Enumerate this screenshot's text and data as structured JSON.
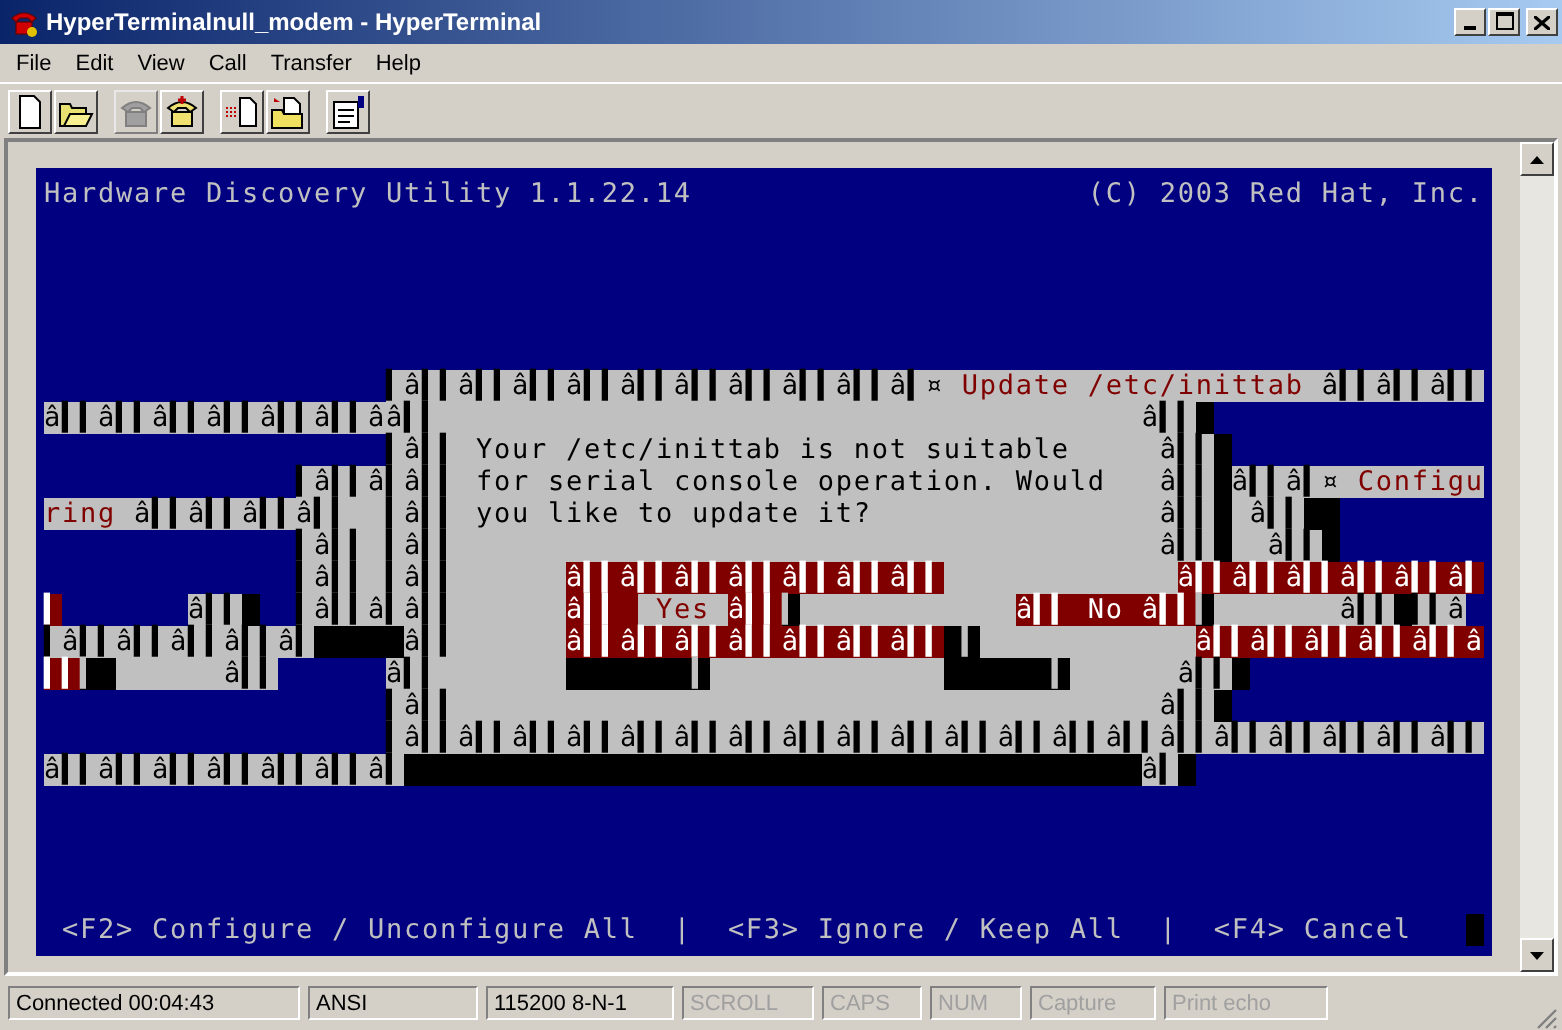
{
  "window": {
    "title": "HyperTerminalnull_modem - HyperTerminal"
  },
  "menu": [
    "File",
    "Edit",
    "View",
    "Call",
    "Transfer",
    "Help"
  ],
  "toolbar": [
    [
      {
        "kind": "new",
        "disabled": false
      },
      {
        "kind": "open",
        "disabled": false
      }
    ],
    [
      {
        "kind": "phone",
        "disabled": true
      },
      {
        "kind": "disconnect",
        "disabled": false
      }
    ],
    [
      {
        "kind": "send",
        "disabled": false
      },
      {
        "kind": "receive",
        "disabled": false
      }
    ],
    [
      {
        "kind": "properties",
        "disabled": false
      }
    ]
  ],
  "terminal": {
    "header": [
      {
        "text": "Hardware Discovery Utility 1.1.22.14",
        "kind": "blue"
      },
      {
        "text": "                      (C) 2003 Red Hat, Inc.",
        "kind": "blue"
      }
    ],
    "body": [
      [
        {
          "text": "                   ▍â▍▍â▍▍â▍▍â▍▍â▍▍â▍▍â▍▍â▍▍â▍▍â▍¤ ",
          "kind": "gray",
          "lead_blue": true
        },
        {
          "text": "Update /etc/inittab",
          "kind": "accent"
        },
        {
          "text": " â▍▍â▍▍â▍▍",
          "kind": "gray"
        }
      ],
      [
        {
          "text": "â▍▍â▍▍â▍▍â▍▍â▍▍â▍▍ââ▍▍                                       â▍▍ ",
          "kind": "gray",
          "trail_black": true
        }
      ],
      [
        {
          "text": "                   ▍â▍▍ ",
          "kind": "gray",
          "lead_blue": true
        },
        {
          "text": "Your /etc/inittab is not suitable",
          "kind": "gray"
        },
        {
          "text": "     â▍▍ ",
          "kind": "gray",
          "trail_black": true
        }
      ],
      [
        {
          "text": "              ▍â▍▍â",
          "kind": "gray",
          "lead_blue": true
        },
        {
          "text": "▍â▍▍ ",
          "kind": "gray"
        },
        {
          "text": "for serial console operation. Would",
          "kind": "gray"
        },
        {
          "text": "   â▍▍ ",
          "kind": "gray",
          "trail_black": true
        },
        {
          "text": "â▍▍â▍¤ ",
          "kind": "gray"
        },
        {
          "text": "Configu",
          "kind": "accent"
        }
      ],
      [
        {
          "text": "ring",
          "kind": "accent"
        },
        {
          "text": " â▍▍â▍▍â▍▍â▍▍  ",
          "kind": "gray"
        },
        {
          "text": "▍â▍▍ ",
          "kind": "gray"
        },
        {
          "text": "you like to update it?",
          "kind": "gray"
        },
        {
          "text": "                â▍▍ ",
          "kind": "gray",
          "trail_black": true
        },
        {
          "text": " â▍▍  ",
          "kind": "gray",
          "trail_black": true
        }
      ],
      [
        {
          "text": "              ▍â▍▍ ",
          "kind": "gray",
          "lead_blue": true
        },
        {
          "text": "▍â▍▍                                       â▍▍ ",
          "kind": "gray",
          "trail_black": true
        },
        {
          "text": "  â▍▍ ",
          "kind": "gray",
          "trail_black": true
        }
      ],
      [
        {
          "text": "              ▍â▍▍ ▍â▍▍      ",
          "kind": "gray",
          "lead_blue": true
        },
        {
          "text": "â▍▍â▍▍â▍▍â▍▍â▍▍â▍▍â▍▍             ",
          "kind": "red",
          "trail_gray": true
        },
        {
          "text": "â▍▍â▍▍â▍▍â▍▍â▍▍â▍",
          "kind": "red"
        }
      ],
      [
        {
          "text": "▍       ",
          "kind": "red",
          "trail_blue": true
        },
        {
          "text": "â▍▍ ",
          "kind": "gray",
          "trail_black": true
        },
        {
          "text": "  ▍â▍▍â▍â▍▍      ",
          "kind": "gray",
          "lead_blue": true
        },
        {
          "text": "â▍▍ ",
          "kind": "red"
        },
        {
          "text": " Yes ",
          "kind": "accent"
        },
        {
          "text": "â▍▍",
          "kind": "red"
        },
        {
          "text": "▍            ",
          "kind": "black",
          "trail_gray": true
        },
        {
          "text": "â▍▍ No â▍▍",
          "kind": "red"
        },
        {
          "text": "▍       ",
          "kind": "black",
          "trail_gray": true
        },
        {
          "text": "â▍▍ ",
          "kind": "gray",
          "trail_black": true
        },
        {
          "text": "▍▍â",
          "kind": "gray"
        }
      ],
      [
        {
          "text": "▍â▍▍â▍▍â▍▍â▍▍â▍     ",
          "kind": "gray",
          "trail_black": true
        },
        {
          "text": "â▍▍      ",
          "kind": "gray"
        },
        {
          "text": "â▍▍â▍▍â▍▍â▍▍â▍▍â▍▍â▍▍",
          "kind": "red"
        },
        {
          "text": " ▍            ",
          "kind": "black",
          "trail_gray": true
        },
        {
          "text": "â▍▍â▍▍â▍▍â▍▍â▍▍â",
          "kind": "red"
        }
      ],
      [
        {
          "text": "▍▍",
          "kind": "red"
        },
        {
          "text": "▍ ",
          "kind": "black"
        },
        {
          "text": "      â▍▍      ",
          "kind": "gray",
          "trail_blue": true
        },
        {
          "text": "â▍▍       ",
          "kind": "gray"
        },
        {
          "text": "       ▍             ",
          "kind": "black",
          "trail_gray": true
        },
        {
          "text": "      ▍      ",
          "kind": "black",
          "trail_gray": true
        },
        {
          "text": "â▍▍ ",
          "kind": "gray",
          "trail_black": true
        }
      ],
      [
        {
          "text": "                   ▍â▍▍                                       â▍▍ ",
          "kind": "gray",
          "lead_blue": true,
          "trail_black": true
        }
      ],
      [
        {
          "text": "                   ▍â▍▍â▍▍â▍▍â▍▍â▍▍â▍▍â▍▍â▍▍â▍▍â▍▍â▍▍â▍▍â▍▍â▍▍â▍▍â▍▍â▍▍â▍▍â▍▍â▍▍",
          "kind": "gray",
          "lead_blue": true
        }
      ],
      [
        {
          "text": "â▍▍â▍▍â▍▍â▍▍â▍▍â▍▍â▍                                         ",
          "kind": "gray",
          "trail_black": true
        },
        {
          "text": "â▍ ",
          "kind": "gray",
          "trail_black": true
        }
      ]
    ],
    "footer": [
      {
        "text": " <F2> Configure / Unconfigure All",
        "kind": "blue"
      },
      {
        "text": "  |  ",
        "kind": "blue"
      },
      {
        "text": "<F3> Ignore / Keep All",
        "kind": "blue"
      },
      {
        "text": "  |  ",
        "kind": "blue"
      },
      {
        "text": "<F4> Cancel   ",
        "kind": "blue"
      }
    ],
    "cursor": true
  },
  "status_bar": [
    {
      "text": "Connected 00:04:43",
      "disabled": false
    },
    {
      "text": "ANSI",
      "disabled": false
    },
    {
      "text": "115200 8-N-1",
      "disabled": false
    },
    {
      "text": "SCROLL",
      "disabled": true
    },
    {
      "text": "CAPS",
      "disabled": true
    },
    {
      "text": "NUM",
      "disabled": true
    },
    {
      "text": "Capture",
      "disabled": true
    },
    {
      "text": "Print echo",
      "disabled": true
    }
  ]
}
